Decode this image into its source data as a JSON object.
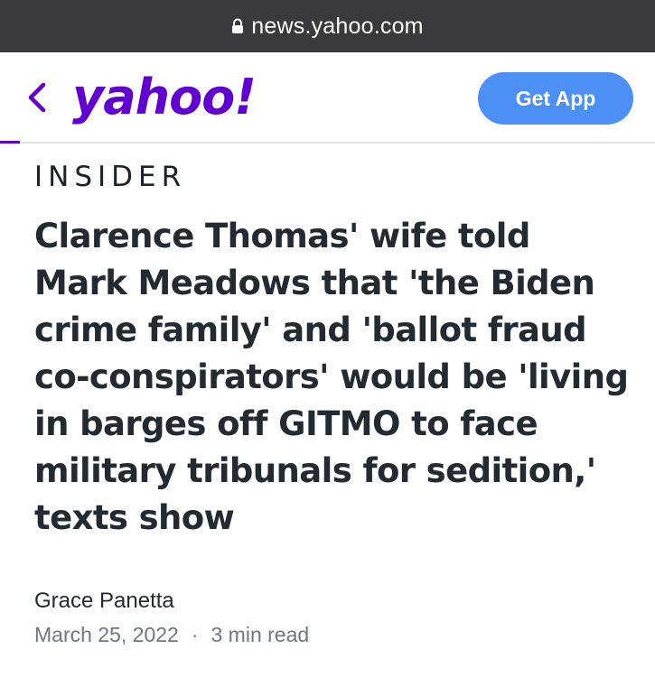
{
  "browser": {
    "url": "news.yahoo.com",
    "lock_icon": "lock-icon"
  },
  "header": {
    "back_icon": "chevron-left-icon",
    "logo_text": "yahoo!",
    "get_app_label": "Get App",
    "accent_color": "#6001d2",
    "button_color": "#4d90f5"
  },
  "article": {
    "publisher": "INSIDER",
    "headline": "Clarence Thomas' wife told Mark Meadows that 'the Biden crime family' and 'ballot fraud co-conspirators' would be 'living in barges off GITMO to face military tribunals for sedition,' texts show",
    "author": "Grace Panetta",
    "date": "March 25, 2022",
    "separator": "·",
    "read_time": "3 min read"
  }
}
